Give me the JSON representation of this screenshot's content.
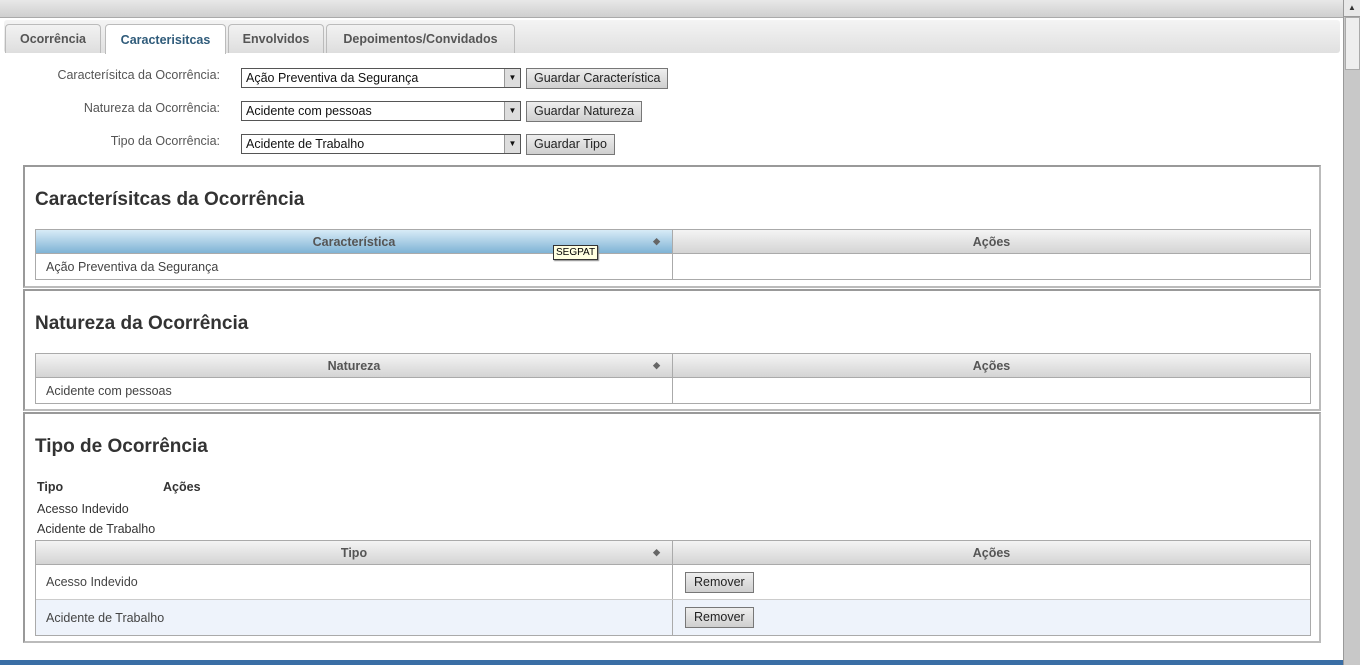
{
  "tabs": [
    "Ocorrência",
    "Caracterisitcas",
    "Envolvidos",
    "Depoimentos/Convidados"
  ],
  "form": {
    "caracteristica": {
      "label": "Caracterísitca da Ocorrência:",
      "value": "Ação Preventiva da Segurança",
      "button": "Guardar Característica"
    },
    "natureza": {
      "label": "Natureza da Ocorrência:",
      "value": "Acidente com pessoas",
      "button": "Guardar Natureza"
    },
    "tipo": {
      "label": "Tipo da Ocorrência:",
      "value": "Acidente de Trabalho",
      "button": "Guardar Tipo"
    }
  },
  "panels": {
    "caracteristicas": {
      "title": "Caracterísitcas da Ocorrência",
      "col1": "Característica",
      "col2": "Ações",
      "rows": [
        "Ação Preventiva da Segurança"
      ]
    },
    "natureza": {
      "title": "Natureza da Ocorrência",
      "col1": "Natureza",
      "col2": "Ações",
      "rows": [
        "Acidente com pessoas"
      ]
    },
    "tipo": {
      "title": "Tipo de Ocorrência",
      "plain_header": [
        "Tipo",
        "Ações"
      ],
      "plain_rows": [
        "Acesso Indevido",
        "Acidente de Trabalho"
      ],
      "col1": "Tipo",
      "col2": "Ações",
      "rows": [
        "Acesso Indevido",
        "Acidente de Trabalho"
      ],
      "remove": "Remover"
    }
  },
  "tooltip": "SEGPAT"
}
